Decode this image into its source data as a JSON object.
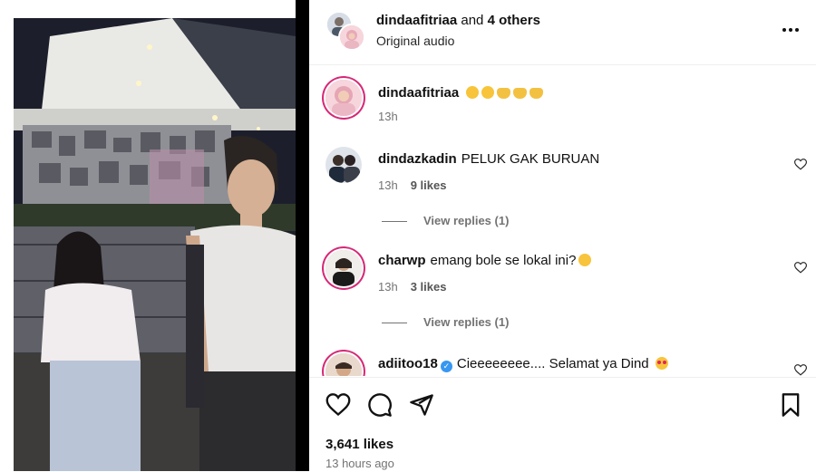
{
  "header": {
    "username": "dindaafitriaa",
    "collab_text": "and",
    "others_text": "4 others",
    "audio_label": "Original audio"
  },
  "caption": {
    "username": "dindaafitriaa",
    "emojis": [
      "pleading-face",
      "pleading-face",
      "heart-hands",
      "heart-hands",
      "heart-hands"
    ],
    "time": "13h"
  },
  "comments": [
    {
      "username": "dindazkadin",
      "text": "PELUK GAK BURUAN",
      "time": "13h",
      "likes": "9 likes",
      "replies": "View replies (1)"
    },
    {
      "username": "charwp",
      "text": "emang bole se lokal ini?",
      "emoji": "laughing-tears",
      "time": "13h",
      "likes": "3 likes",
      "replies": "View replies (1)"
    },
    {
      "username": "adiitoo18",
      "verified": true,
      "text": "Cieeeeeeee.... Selamat ya Dind",
      "emoji": "heart-eyes"
    }
  ],
  "actions": {
    "likes_count": "3,641 likes",
    "posted_ago": "13 hours ago"
  },
  "colors": {
    "story_ring": "#d62976",
    "verified": "#3897f0",
    "muted_text": "#737373"
  }
}
